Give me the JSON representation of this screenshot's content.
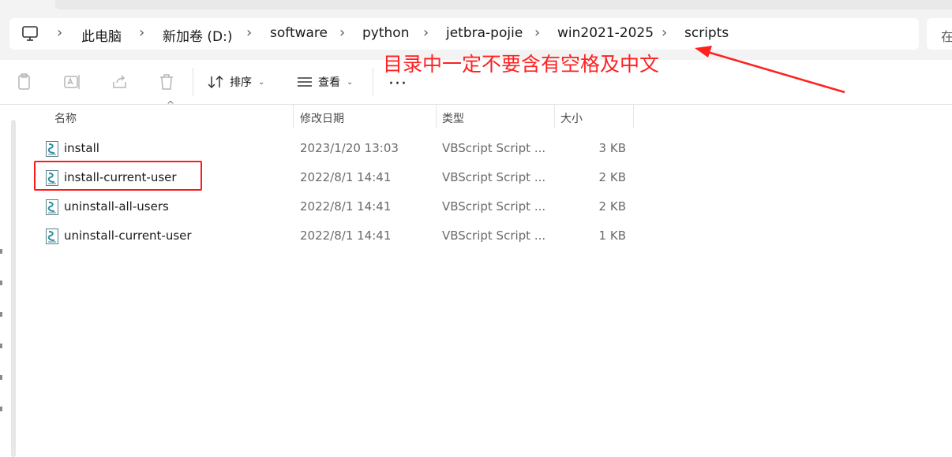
{
  "address_bar": {
    "breadcrumbs": [
      "此电脑",
      "新加卷 (D:)",
      "software",
      "python",
      "jetbra-pojie",
      "win2021-2025",
      "scripts"
    ],
    "search_placeholder": "在"
  },
  "toolbar": {
    "sort_label": "排序",
    "view_label": "查看",
    "more_label": "···"
  },
  "annotation": {
    "text": "目录中一定不要含有空格及中文",
    "color": "#ff2020"
  },
  "columns": [
    "名称",
    "修改日期",
    "类型",
    "大小"
  ],
  "files": [
    {
      "name": "install",
      "date": "2023/1/20 13:03",
      "type": "VBScript Script ...",
      "size": "3 KB"
    },
    {
      "name": "install-current-user",
      "date": "2022/8/1 14:41",
      "type": "VBScript Script ...",
      "size": "2 KB"
    },
    {
      "name": "uninstall-all-users",
      "date": "2022/8/1 14:41",
      "type": "VBScript Script ...",
      "size": "2 KB"
    },
    {
      "name": "uninstall-current-user",
      "date": "2022/8/1 14:41",
      "type": "VBScript Script ...",
      "size": "1 KB"
    }
  ]
}
